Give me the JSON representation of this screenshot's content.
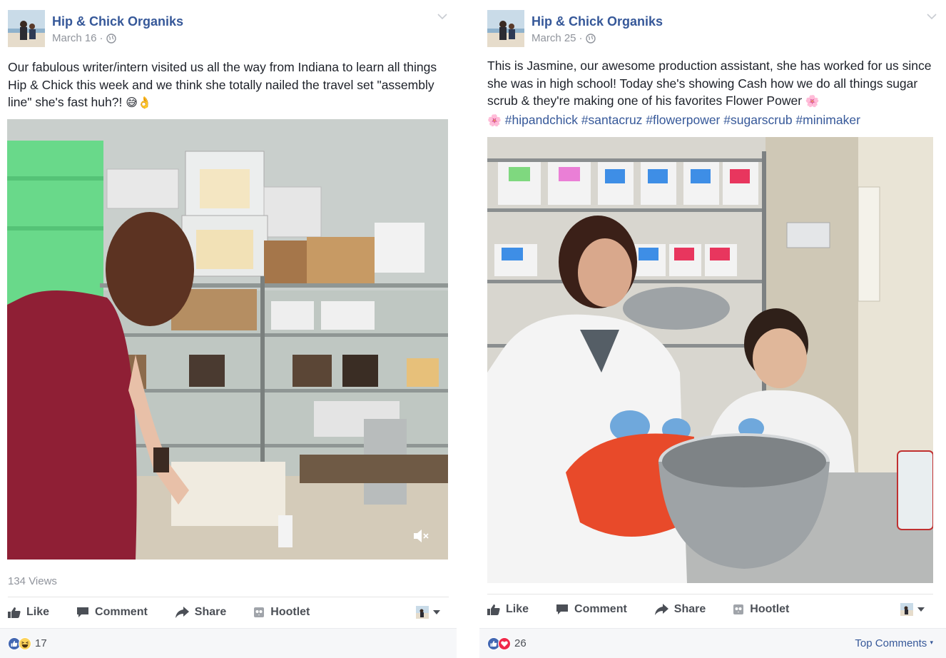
{
  "posts": [
    {
      "page_name": "Hip & Chick Organiks",
      "date": "March 16",
      "privacy_icon": "globe-icon",
      "text": "Our fabulous writer/intern visited us all the way from Indiana to learn all things Hip & Chick this week and we think she totally nailed the travel set \"assembly line\" she's fast huh?!",
      "emojis": [
        "😅",
        "👌"
      ],
      "media_type": "video",
      "views": "134 Views",
      "actions": {
        "like": "Like",
        "comment": "Comment",
        "share": "Share",
        "hootlet": "Hootlet"
      },
      "reactions": {
        "icons": [
          "like-reaction-icon",
          "haha-reaction-icon"
        ],
        "count": "17"
      }
    },
    {
      "page_name": "Hip & Chick Organiks",
      "date": "March 25",
      "privacy_icon": "globe-icon",
      "text": "This is Jasmine, our awesome production assistant, she has worked for us since she was in high school! Today she's showing Cash how we do all things sugar scrub & they're making one of his favorites Flower Power",
      "emojis": [
        "🌸",
        "🌸"
      ],
      "hashtags": [
        "#hipandchick",
        "#santacruz",
        "#flowerpower",
        "#sugarscrub",
        "#minimaker"
      ],
      "media_type": "photo",
      "actions": {
        "like": "Like",
        "comment": "Comment",
        "share": "Share",
        "hootlet": "Hootlet"
      },
      "reactions": {
        "icons": [
          "like-reaction-icon",
          "love-reaction-icon"
        ],
        "count": "26"
      },
      "top_comments": "Top Comments"
    }
  ],
  "colors": {
    "link": "#365899",
    "secondary_text": "#90949c",
    "action_text": "#4b4f56",
    "like_blue": "#4267b2",
    "love_red": "#f0284a"
  }
}
